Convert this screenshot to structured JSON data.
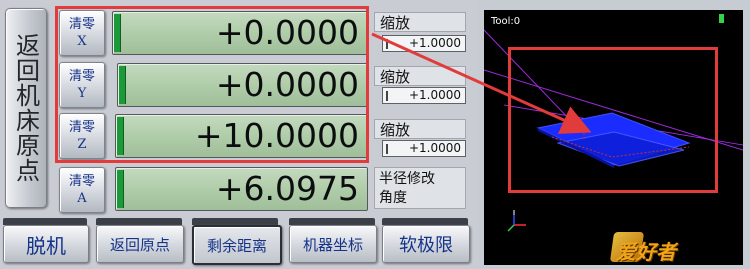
{
  "home_button_label": "返回机床原点",
  "axes": [
    {
      "zero_label": "清零",
      "axis": "X",
      "value": "+0.0000",
      "scale_label": "缩放",
      "scale_value": "+1.0000"
    },
    {
      "zero_label": "清零",
      "axis": "Y",
      "value": "+0.0000",
      "scale_label": "缩放",
      "scale_value": "+1.0000"
    },
    {
      "zero_label": "清零",
      "axis": "Z",
      "value": "+10.0000",
      "scale_label": "缩放",
      "scale_value": "+1.0000"
    },
    {
      "zero_label": "清零",
      "axis": "A",
      "value": "+6.0975",
      "radius_label": "半径修改",
      "angle_label": "角度"
    }
  ],
  "bottom_buttons": [
    {
      "label": "脱机"
    },
    {
      "label": "返回原点"
    },
    {
      "label": "剩余距离"
    },
    {
      "label": "机器坐标"
    },
    {
      "label": "软极限"
    }
  ],
  "view3d": {
    "title": "Tool:0"
  },
  "watermark": "爱好者",
  "colors": {
    "annotation": "#e23b3b",
    "dro_bg": "#b0cdaa",
    "toolpath": "#1a2cff",
    "view_bg": "#000000"
  }
}
